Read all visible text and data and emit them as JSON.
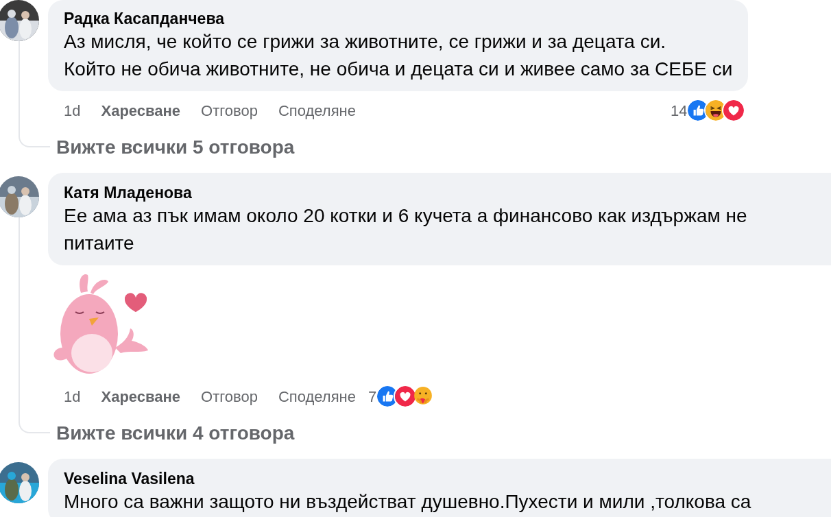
{
  "comments": [
    {
      "author": "Радка Касапданчева",
      "text_lines": [
        "Аз мисля, че който се грижи за животните, се грижи и за децата си.",
        "Който не обича животните, не обича и децата си и живее само за СЕБЕ си"
      ],
      "time": "1d",
      "actions": [
        "Харесване",
        "Отговор",
        "Споделяне"
      ],
      "reactions": {
        "count": "14",
        "icons": [
          {
            "kind": "like"
          },
          {
            "kind": "haha"
          },
          {
            "kind": "love"
          }
        ]
      },
      "replies_link": "Вижте всички 5 отговора"
    },
    {
      "author": "Катя Младенова",
      "text_lines": [
        "Ее ама аз пък имам около 20 котки и 6 кучета а финансово как издържам не",
        "питаите"
      ],
      "attachment": {
        "kind": "sticker"
      },
      "time": "1d",
      "actions": [
        "Харесване",
        "Отговор",
        "Споделяне"
      ],
      "reactions": {
        "count": "7",
        "icons": [
          {
            "kind": "like"
          },
          {
            "kind": "love"
          },
          {
            "kind": "care"
          }
        ]
      },
      "replies_link": "Вижте всички 4 отговора"
    },
    {
      "author": "Veselina Vasilena",
      "text_lines": [
        "Много са важни защото ни въздействат душевно.Пухести и мили ,толкова са"
      ]
    }
  ]
}
